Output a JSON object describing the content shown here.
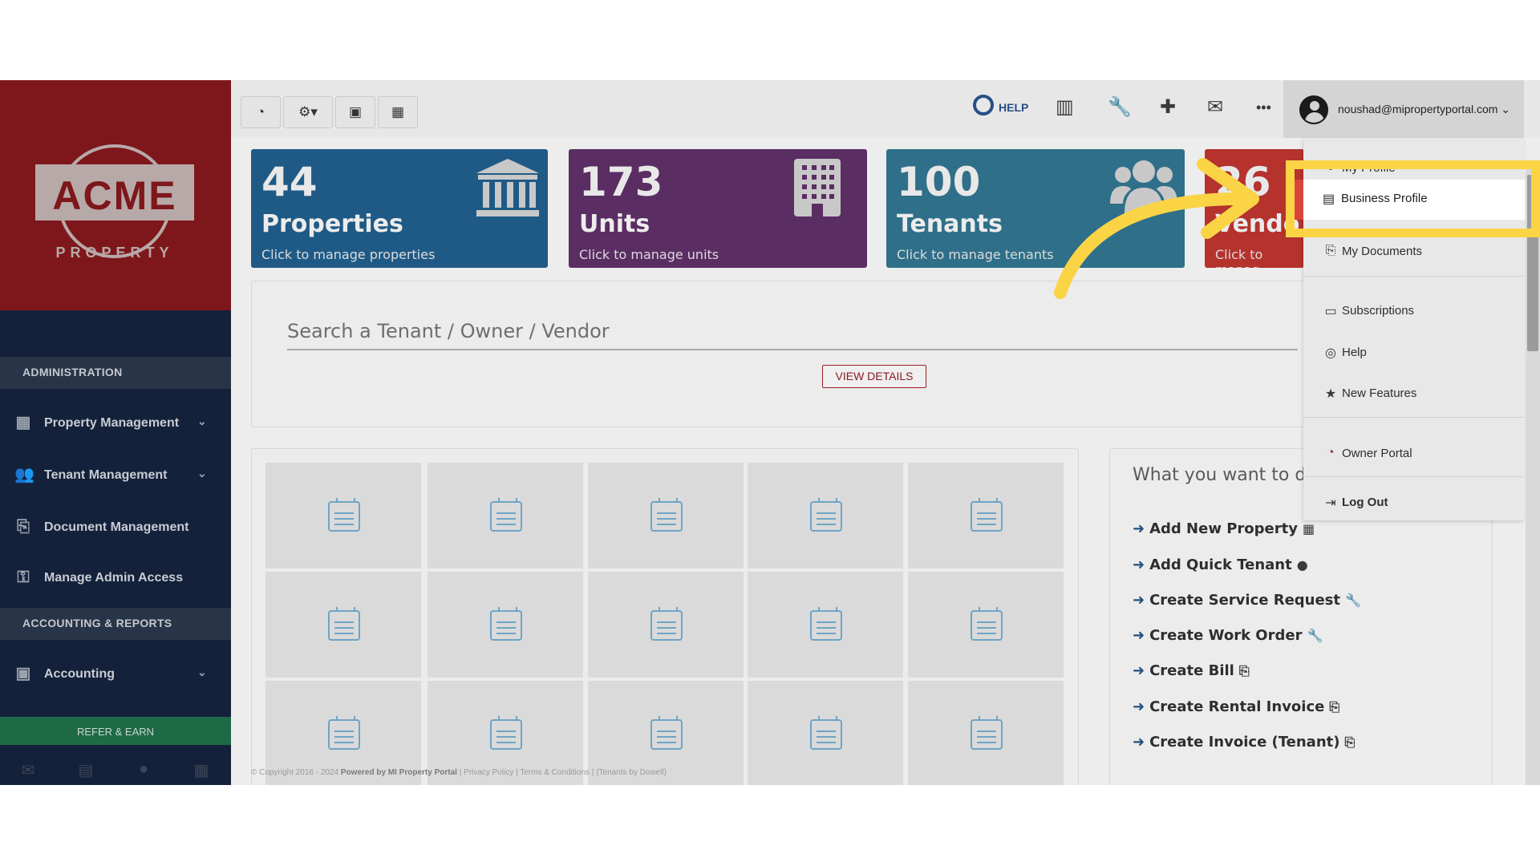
{
  "brand": {
    "logo_text": "ACME",
    "logo_sub": "PROPERTY"
  },
  "sidebar": {
    "sections": [
      {
        "label": "ADMINISTRATION"
      },
      {
        "label": "ACCOUNTING & REPORTS"
      }
    ],
    "items": [
      {
        "label": "Property Management",
        "icon": "building-icon",
        "has_submenu": true
      },
      {
        "label": "Tenant Management",
        "icon": "users-icon",
        "has_submenu": true
      },
      {
        "label": "Document Management",
        "icon": "documents-icon",
        "has_submenu": false
      },
      {
        "label": "Manage Admin Access",
        "icon": "key-icon",
        "has_submenu": false
      },
      {
        "label": "Accounting",
        "icon": "money-icon",
        "has_submenu": true
      }
    ],
    "refer_label": "REFER & EARN",
    "bottom_icons": [
      "mail-icon",
      "briefcase-icon",
      "user-icon",
      "calculator-icon"
    ]
  },
  "toolbar": {
    "left_buttons": [
      "dashboard-icon",
      "gear-icon",
      "calendar-check-icon",
      "calculator-icon"
    ],
    "help_label": "HELP",
    "right_icons": [
      "bar-chart-icon",
      "wrench-icon",
      "plus-icon",
      "mail-icon",
      "ellipsis-icon"
    ],
    "user_email": "noushad@mipropertyportal.com"
  },
  "stats": [
    {
      "number": "44",
      "title": "Properties",
      "subtitle": "Click to manage properties",
      "color": "#1f5a86",
      "icon": "bank-icon"
    },
    {
      "number": "173",
      "title": "Units",
      "subtitle": "Click to manage units",
      "color": "#5a2d63",
      "icon": "building-icon"
    },
    {
      "number": "100",
      "title": "Tenants",
      "subtitle": "Click to manage tenants",
      "color": "#2f6f89",
      "icon": "users-icon"
    },
    {
      "number": "26",
      "title": "Vendo",
      "subtitle": "Click to manag",
      "color": "#b5322d",
      "icon": ""
    }
  ],
  "search": {
    "placeholder": "Search a Tenant / Owner / Vendor",
    "button_label": "VIEW DETAILS"
  },
  "actions": {
    "title": "What you want to d",
    "items": [
      {
        "label": "Add New Property",
        "icon": "building-icon"
      },
      {
        "label": "Add Quick Tenant",
        "icon": "user-icon"
      },
      {
        "label": "Create Service Request",
        "icon": "wrench-icon"
      },
      {
        "label": "Create Work Order",
        "icon": "wrench-icon"
      },
      {
        "label": "Create Bill",
        "icon": "copy-icon"
      },
      {
        "label": "Create Rental Invoice",
        "icon": "copy-icon"
      },
      {
        "label": "Create Invoice (Tenant)",
        "icon": "copy-icon"
      }
    ]
  },
  "dropdown": {
    "items": [
      {
        "label": "My Profile",
        "icon": "user-icon"
      },
      {
        "label": "Business Profile",
        "icon": "briefcase-icon",
        "active": true
      },
      {
        "label": "My Documents",
        "icon": "documents-icon"
      },
      {
        "label": "Subscriptions",
        "icon": "credit-card-icon"
      },
      {
        "label": "Help",
        "icon": "lifebuoy-icon"
      },
      {
        "label": "New Features",
        "icon": "star-icon"
      },
      {
        "label": "Owner Portal",
        "icon": "dashboard-icon"
      },
      {
        "label": "Log Out",
        "icon": "logout-icon"
      }
    ]
  },
  "footer": {
    "copyright": "© Copyright 2016 - 2024",
    "powered": "Powered by MI Property Portal",
    "links": [
      "Privacy Policy",
      "Terms & Conditions"
    ],
    "tenants": "(Tenants by Dowell)"
  },
  "colors": {
    "highlight": "#fbd446",
    "accent_red": "#9b1d24",
    "sidebar_bg": "#14213a"
  }
}
